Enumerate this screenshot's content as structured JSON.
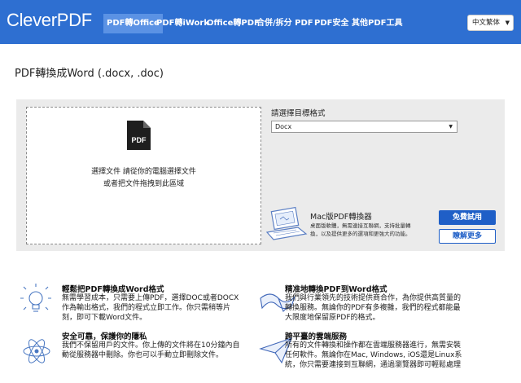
{
  "header": {
    "logo": "CleverPDF",
    "nav": [
      "PDF轉Office",
      "PDF轉iWork",
      "Office轉PDF",
      "合併/拆分 PDF",
      "PDF安全",
      "其他PDF工具"
    ],
    "language": "中文繁体"
  },
  "page_title": "PDF轉換成Word (.docx, .doc)",
  "upload": {
    "file_icon_label": "PDF",
    "line1": "選擇文件 請從你的電腦選擇文件",
    "line2": "或者把文件拖拽到此區域"
  },
  "format": {
    "label": "請選擇目標格式",
    "selected": "Docx"
  },
  "mac": {
    "title": "Mac版PDF轉換器",
    "desc_line1": "桌面版軟體，無需連接互聯網，支持批量轉",
    "desc_line2": "換，以及提供更多的選項和更強大的功能。",
    "trial_button": "免費試用",
    "more_button": "瞭解更多"
  },
  "features": [
    {
      "title": "輕鬆把PDF轉換成Word格式",
      "lines": [
        "無需學習成本，只需要上傳PDF，選擇DOC或者DOCX",
        "作為輸出格式，我們的程式立即工作。你只需稍等片",
        "刻，即可下載Word文件。"
      ],
      "icon": "lightbulb-icon"
    },
    {
      "title": "精准地轉換PDF到Word格式",
      "lines": [
        "我們與行業領先的技術提供商合作，為你提供高質量的",
        "轉換服務。無論你的PDF有多複雜，我們的程式都能最",
        "大限度地保留原PDF的格式。"
      ],
      "icon": "ribbon-icon"
    },
    {
      "title": "安全可靠，保護你的隱私",
      "lines": [
        "我們不保留用戶的文件。你上傳的文件將在10分鐘內自",
        "動從服務器中刪除。你也可以手動立即刪除文件。"
      ],
      "icon": "atom-icon"
    },
    {
      "title": "跨平臺的雲端服務",
      "lines": [
        "所有的文件轉換和操作都在雲端服務器進行，無需安裝",
        "任何軟件。無論你在Mac, Windows, iOS還是Linux系",
        "統，你只需要連接到互聯網，通過瀏覽器即可輕鬆處理"
      ],
      "icon": "paper-plane-icon"
    }
  ],
  "colors": {
    "nav_bg": "#2e6fd1",
    "nav_active": "#5b92e4",
    "button_primary": "#1f5fc7",
    "panel_bg": "#ebebeb"
  }
}
